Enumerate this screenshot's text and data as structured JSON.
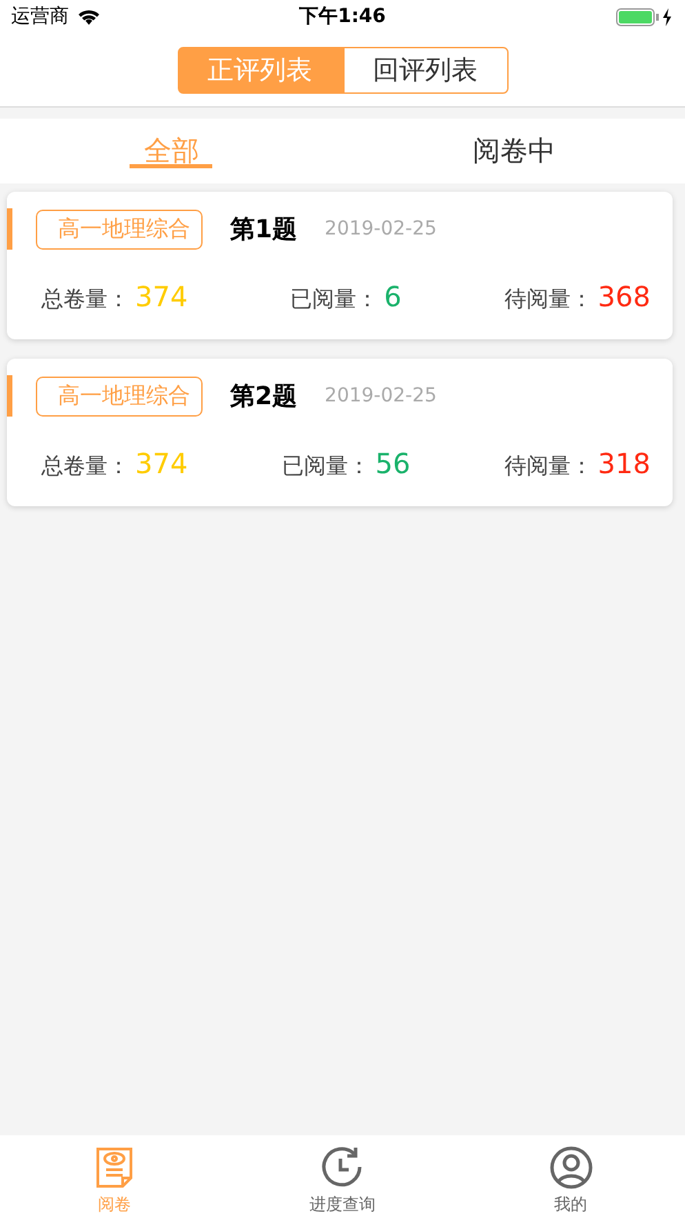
{
  "status_bar": {
    "carrier": "运营商",
    "time": "下午1:46"
  },
  "segments": [
    {
      "label": "正评列表",
      "selected": true
    },
    {
      "label": "回评列表",
      "selected": false
    }
  ],
  "tabs": [
    {
      "label": "全部",
      "selected": true
    },
    {
      "label": "阅卷中",
      "selected": false
    }
  ],
  "cards": [
    {
      "subject": "高一地理综合",
      "question": "第1题",
      "date": "2019-02-25",
      "stats": [
        {
          "label": "总卷量：",
          "value": "374",
          "color": "#ffcc00"
        },
        {
          "label": "已阅量：",
          "value": "6",
          "color": "#1ab26b"
        },
        {
          "label": "待阅量：",
          "value": "368",
          "color": "#ff2a12"
        }
      ]
    },
    {
      "subject": "高一地理综合",
      "question": "第2题",
      "date": "2019-02-25",
      "stats": [
        {
          "label": "总卷量：",
          "value": "374",
          "color": "#ffcc00"
        },
        {
          "label": "已阅量：",
          "value": "56",
          "color": "#1ab26b"
        },
        {
          "label": "待阅量：",
          "value": "318",
          "color": "#ff2a12"
        }
      ]
    }
  ],
  "bottom_nav": [
    {
      "kind": "paper",
      "label": "阅卷",
      "selected": true
    },
    {
      "kind": "history",
      "label": "进度查询",
      "selected": false
    },
    {
      "kind": "profile",
      "label": "我的",
      "selected": false
    }
  ]
}
